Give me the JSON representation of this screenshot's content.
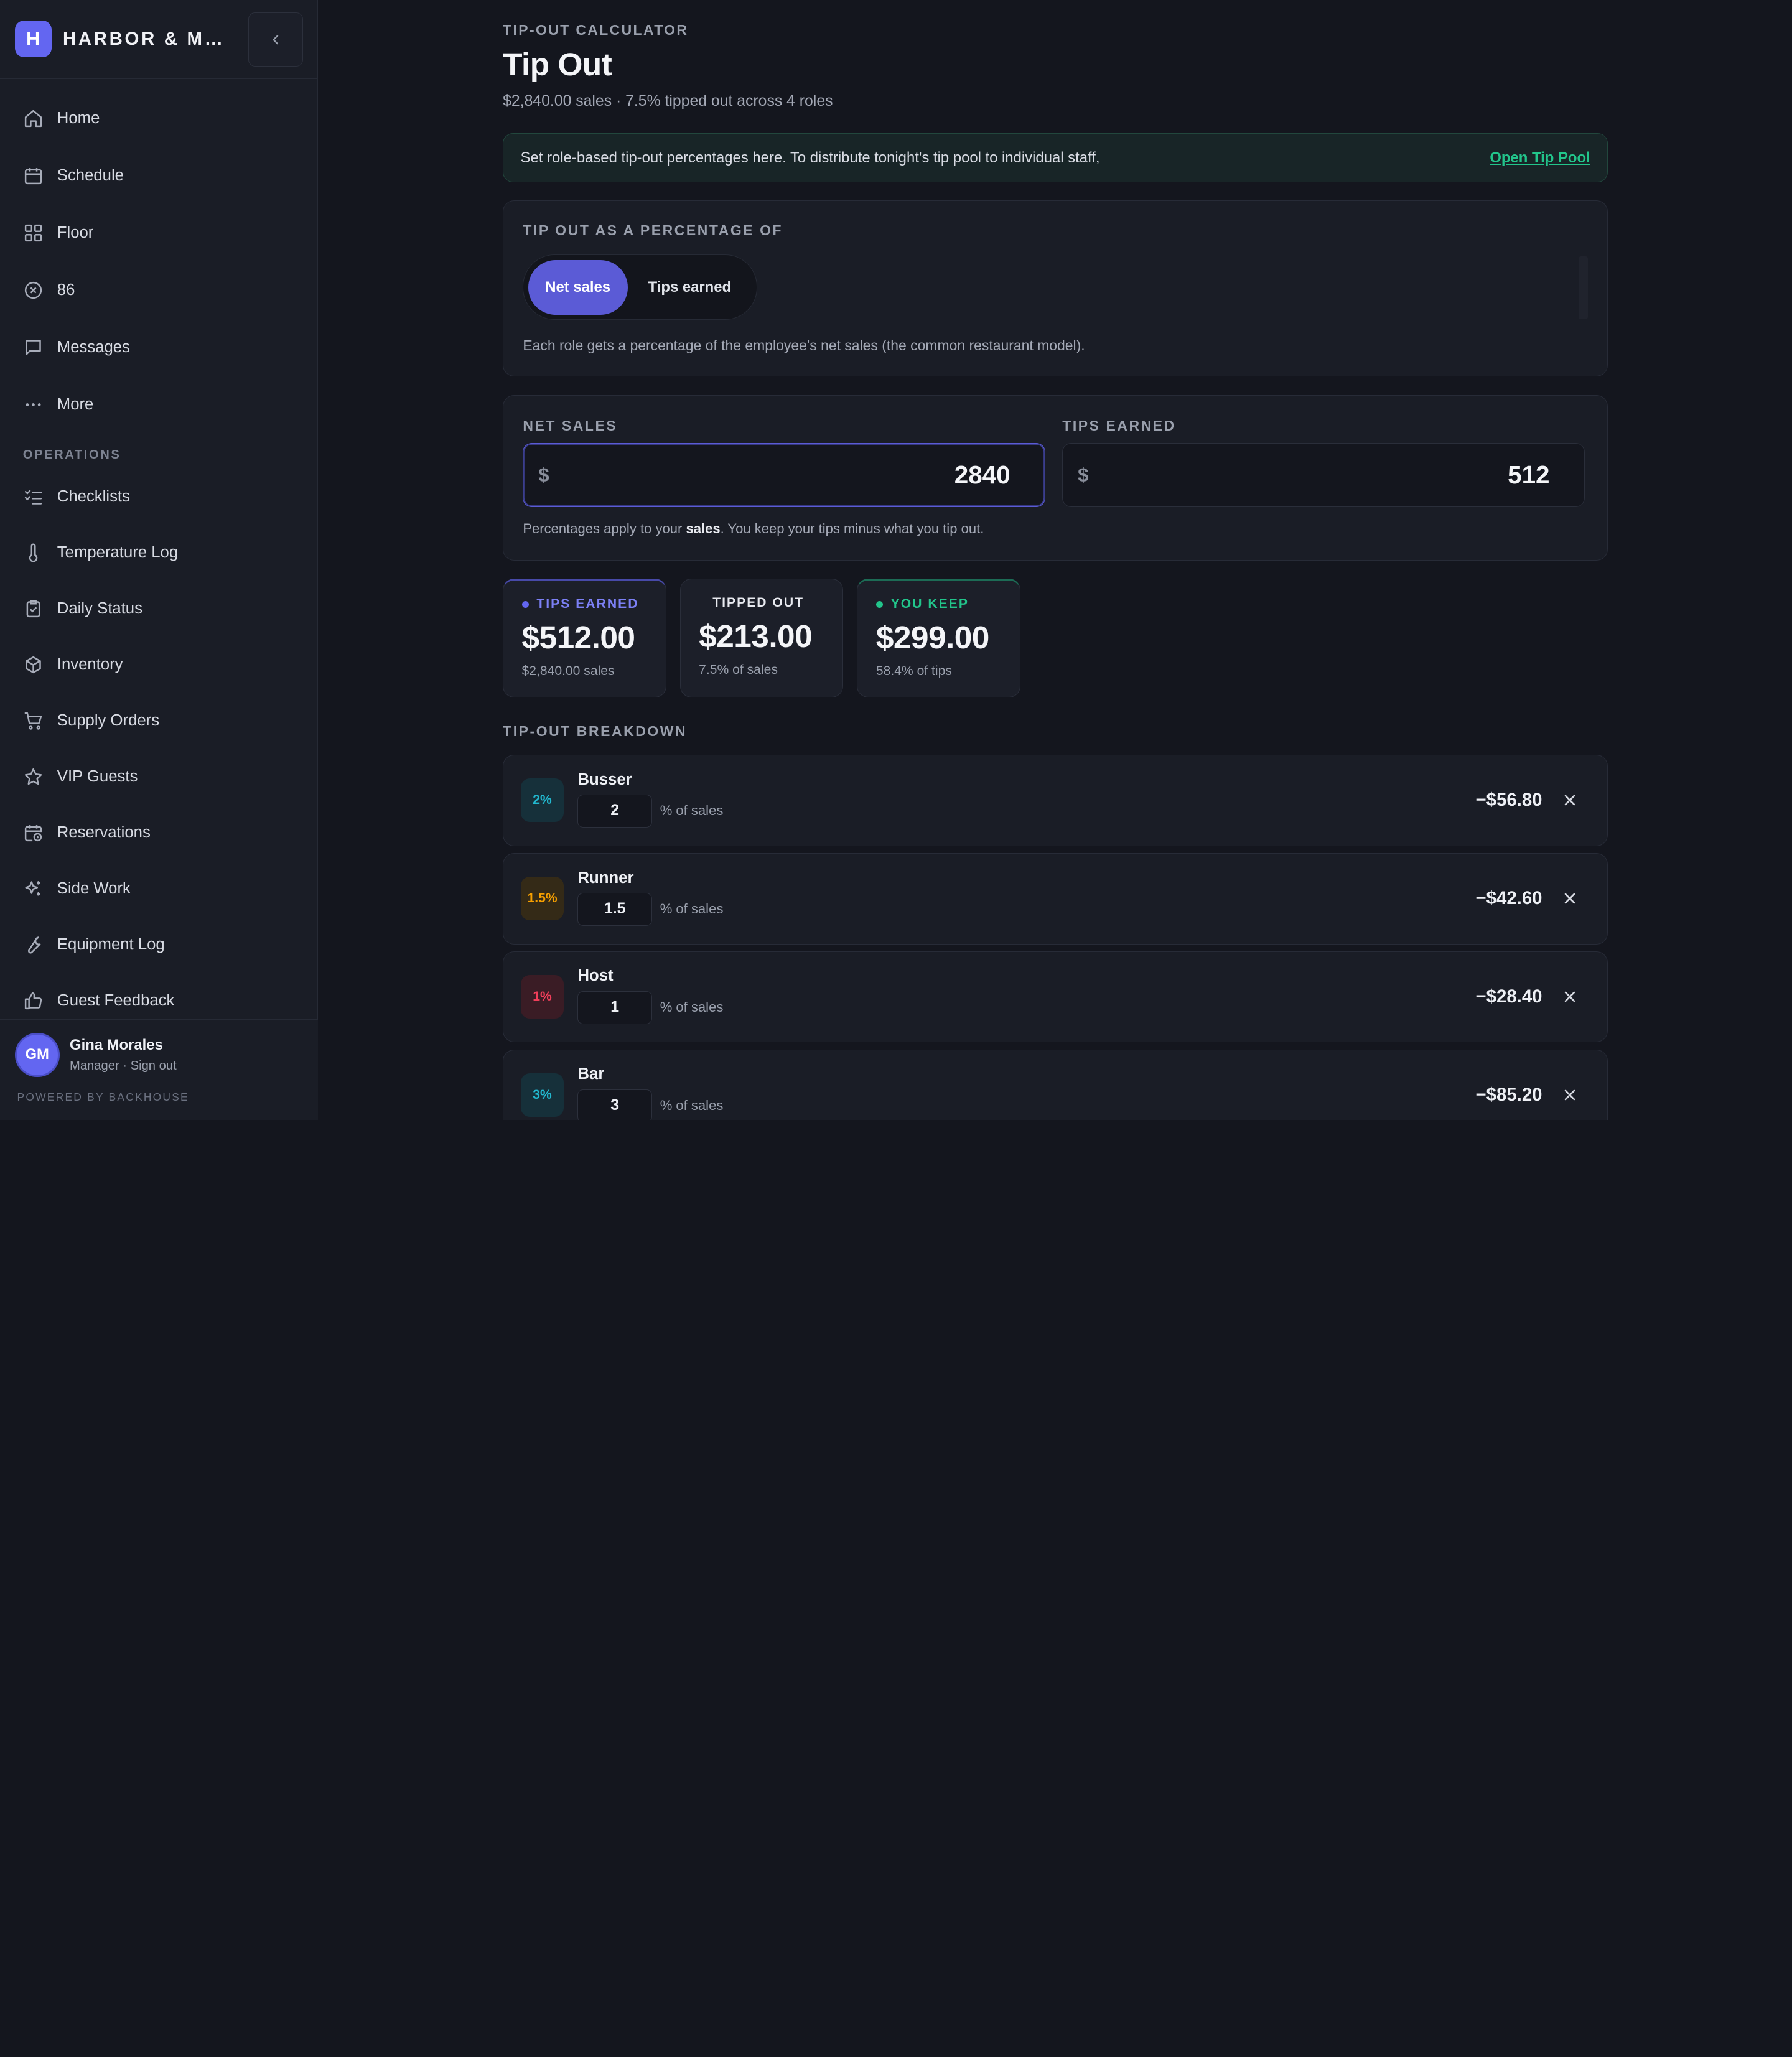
{
  "brand": {
    "logo_letter": "H",
    "name": "HARBOR & MA…"
  },
  "nav": {
    "main": [
      {
        "label": "Home",
        "icon": "home-icon"
      },
      {
        "label": "Schedule",
        "icon": "calendar-icon"
      },
      {
        "label": "Floor",
        "icon": "grid-icon"
      },
      {
        "label": "86",
        "icon": "circle-x-icon"
      },
      {
        "label": "Messages",
        "icon": "message-icon"
      },
      {
        "label": "More",
        "icon": "more-icon"
      }
    ],
    "section_label": "OPERATIONS",
    "operations": [
      {
        "label": "Checklists",
        "icon": "checklist-icon"
      },
      {
        "label": "Temperature Log",
        "icon": "thermometer-icon"
      },
      {
        "label": "Daily Status",
        "icon": "clipboard-check-icon"
      },
      {
        "label": "Inventory",
        "icon": "box-icon"
      },
      {
        "label": "Supply Orders",
        "icon": "cart-icon"
      },
      {
        "label": "VIP Guests",
        "icon": "star-icon"
      },
      {
        "label": "Reservations",
        "icon": "calendar-clock-icon"
      },
      {
        "label": "Side Work",
        "icon": "sparkles-icon"
      },
      {
        "label": "Equipment Log",
        "icon": "wrench-icon"
      },
      {
        "label": "Guest Feedback",
        "icon": "thumbs-up-icon"
      }
    ]
  },
  "user": {
    "initials": "GM",
    "name": "Gina Morales",
    "role_line": "Manager · Sign out",
    "powered_by": "POWERED BY BACKHOUSE"
  },
  "header": {
    "eyebrow": "TIP-OUT CALCULATOR",
    "title": "Tip Out",
    "subtitle": "$2,840.00 sales · 7.5% tipped out across 4 roles"
  },
  "banner": {
    "text": "Set role-based tip-out percentages here. To distribute tonight's tip pool to individual staff,",
    "link": "Open Tip Pool"
  },
  "basis": {
    "label": "TIP OUT AS A PERCENTAGE OF",
    "options": [
      "Net sales",
      "Tips earned"
    ],
    "selected": "Net sales",
    "description": "Each role gets a percentage of the employee's net sales (the common restaurant model)."
  },
  "inputs": {
    "net_sales_label": "NET SALES",
    "net_sales_value": "2840",
    "tips_label": "TIPS EARNED",
    "tips_value": "512",
    "currency": "$",
    "note_before": "Percentages apply to your ",
    "note_bold": "sales",
    "note_after": ". You keep your tips minus what you tip out."
  },
  "stats": {
    "tips": {
      "label": "TIPS EARNED",
      "value": "$512.00",
      "sub": "$2,840.00 sales"
    },
    "tipped": {
      "label": "TIPPED OUT",
      "value": "$213.00",
      "sub": "7.5% of sales"
    },
    "keep": {
      "label": "YOU KEEP",
      "value": "$299.00",
      "sub": "58.4% of tips"
    }
  },
  "breakdown": {
    "label": "TIP-OUT BREAKDOWN",
    "unit": "% of sales",
    "rows": [
      {
        "role": "Busser",
        "badge": "2%",
        "value": "2",
        "amount": "−$56.80",
        "color": "#22b8cf",
        "bg": "#16303a"
      },
      {
        "role": "Runner",
        "badge": "1.5%",
        "value": "1.5",
        "amount": "−$42.60",
        "color": "#f59f00",
        "bg": "#342a17"
      },
      {
        "role": "Host",
        "badge": "1%",
        "value": "1",
        "amount": "−$28.40",
        "color": "#f03e5a",
        "bg": "#3a1c25"
      },
      {
        "role": "Bar",
        "badge": "3%",
        "value": "3",
        "amount": "−$85.20",
        "color": "#22b8cf",
        "bg": "#16303a"
      }
    ]
  },
  "colors": {
    "accent": "#5b5bd6",
    "success": "#22c58b",
    "background": "#14161e"
  }
}
